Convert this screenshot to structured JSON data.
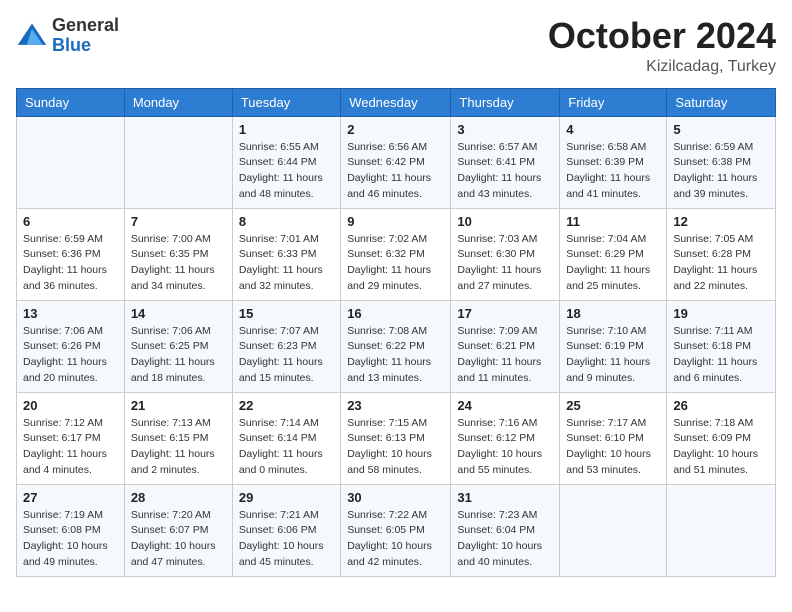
{
  "logo": {
    "general": "General",
    "blue": "Blue"
  },
  "header": {
    "month": "October 2024",
    "location": "Kizilcadag, Turkey"
  },
  "weekdays": [
    "Sunday",
    "Monday",
    "Tuesday",
    "Wednesday",
    "Thursday",
    "Friday",
    "Saturday"
  ],
  "weeks": [
    [
      {
        "day": "",
        "sunrise": "",
        "sunset": "",
        "daylight": ""
      },
      {
        "day": "",
        "sunrise": "",
        "sunset": "",
        "daylight": ""
      },
      {
        "day": "1",
        "sunrise": "Sunrise: 6:55 AM",
        "sunset": "Sunset: 6:44 PM",
        "daylight": "Daylight: 11 hours and 48 minutes."
      },
      {
        "day": "2",
        "sunrise": "Sunrise: 6:56 AM",
        "sunset": "Sunset: 6:42 PM",
        "daylight": "Daylight: 11 hours and 46 minutes."
      },
      {
        "day": "3",
        "sunrise": "Sunrise: 6:57 AM",
        "sunset": "Sunset: 6:41 PM",
        "daylight": "Daylight: 11 hours and 43 minutes."
      },
      {
        "day": "4",
        "sunrise": "Sunrise: 6:58 AM",
        "sunset": "Sunset: 6:39 PM",
        "daylight": "Daylight: 11 hours and 41 minutes."
      },
      {
        "day": "5",
        "sunrise": "Sunrise: 6:59 AM",
        "sunset": "Sunset: 6:38 PM",
        "daylight": "Daylight: 11 hours and 39 minutes."
      }
    ],
    [
      {
        "day": "6",
        "sunrise": "Sunrise: 6:59 AM",
        "sunset": "Sunset: 6:36 PM",
        "daylight": "Daylight: 11 hours and 36 minutes."
      },
      {
        "day": "7",
        "sunrise": "Sunrise: 7:00 AM",
        "sunset": "Sunset: 6:35 PM",
        "daylight": "Daylight: 11 hours and 34 minutes."
      },
      {
        "day": "8",
        "sunrise": "Sunrise: 7:01 AM",
        "sunset": "Sunset: 6:33 PM",
        "daylight": "Daylight: 11 hours and 32 minutes."
      },
      {
        "day": "9",
        "sunrise": "Sunrise: 7:02 AM",
        "sunset": "Sunset: 6:32 PM",
        "daylight": "Daylight: 11 hours and 29 minutes."
      },
      {
        "day": "10",
        "sunrise": "Sunrise: 7:03 AM",
        "sunset": "Sunset: 6:30 PM",
        "daylight": "Daylight: 11 hours and 27 minutes."
      },
      {
        "day": "11",
        "sunrise": "Sunrise: 7:04 AM",
        "sunset": "Sunset: 6:29 PM",
        "daylight": "Daylight: 11 hours and 25 minutes."
      },
      {
        "day": "12",
        "sunrise": "Sunrise: 7:05 AM",
        "sunset": "Sunset: 6:28 PM",
        "daylight": "Daylight: 11 hours and 22 minutes."
      }
    ],
    [
      {
        "day": "13",
        "sunrise": "Sunrise: 7:06 AM",
        "sunset": "Sunset: 6:26 PM",
        "daylight": "Daylight: 11 hours and 20 minutes."
      },
      {
        "day": "14",
        "sunrise": "Sunrise: 7:06 AM",
        "sunset": "Sunset: 6:25 PM",
        "daylight": "Daylight: 11 hours and 18 minutes."
      },
      {
        "day": "15",
        "sunrise": "Sunrise: 7:07 AM",
        "sunset": "Sunset: 6:23 PM",
        "daylight": "Daylight: 11 hours and 15 minutes."
      },
      {
        "day": "16",
        "sunrise": "Sunrise: 7:08 AM",
        "sunset": "Sunset: 6:22 PM",
        "daylight": "Daylight: 11 hours and 13 minutes."
      },
      {
        "day": "17",
        "sunrise": "Sunrise: 7:09 AM",
        "sunset": "Sunset: 6:21 PM",
        "daylight": "Daylight: 11 hours and 11 minutes."
      },
      {
        "day": "18",
        "sunrise": "Sunrise: 7:10 AM",
        "sunset": "Sunset: 6:19 PM",
        "daylight": "Daylight: 11 hours and 9 minutes."
      },
      {
        "day": "19",
        "sunrise": "Sunrise: 7:11 AM",
        "sunset": "Sunset: 6:18 PM",
        "daylight": "Daylight: 11 hours and 6 minutes."
      }
    ],
    [
      {
        "day": "20",
        "sunrise": "Sunrise: 7:12 AM",
        "sunset": "Sunset: 6:17 PM",
        "daylight": "Daylight: 11 hours and 4 minutes."
      },
      {
        "day": "21",
        "sunrise": "Sunrise: 7:13 AM",
        "sunset": "Sunset: 6:15 PM",
        "daylight": "Daylight: 11 hours and 2 minutes."
      },
      {
        "day": "22",
        "sunrise": "Sunrise: 7:14 AM",
        "sunset": "Sunset: 6:14 PM",
        "daylight": "Daylight: 11 hours and 0 minutes."
      },
      {
        "day": "23",
        "sunrise": "Sunrise: 7:15 AM",
        "sunset": "Sunset: 6:13 PM",
        "daylight": "Daylight: 10 hours and 58 minutes."
      },
      {
        "day": "24",
        "sunrise": "Sunrise: 7:16 AM",
        "sunset": "Sunset: 6:12 PM",
        "daylight": "Daylight: 10 hours and 55 minutes."
      },
      {
        "day": "25",
        "sunrise": "Sunrise: 7:17 AM",
        "sunset": "Sunset: 6:10 PM",
        "daylight": "Daylight: 10 hours and 53 minutes."
      },
      {
        "day": "26",
        "sunrise": "Sunrise: 7:18 AM",
        "sunset": "Sunset: 6:09 PM",
        "daylight": "Daylight: 10 hours and 51 minutes."
      }
    ],
    [
      {
        "day": "27",
        "sunrise": "Sunrise: 7:19 AM",
        "sunset": "Sunset: 6:08 PM",
        "daylight": "Daylight: 10 hours and 49 minutes."
      },
      {
        "day": "28",
        "sunrise": "Sunrise: 7:20 AM",
        "sunset": "Sunset: 6:07 PM",
        "daylight": "Daylight: 10 hours and 47 minutes."
      },
      {
        "day": "29",
        "sunrise": "Sunrise: 7:21 AM",
        "sunset": "Sunset: 6:06 PM",
        "daylight": "Daylight: 10 hours and 45 minutes."
      },
      {
        "day": "30",
        "sunrise": "Sunrise: 7:22 AM",
        "sunset": "Sunset: 6:05 PM",
        "daylight": "Daylight: 10 hours and 42 minutes."
      },
      {
        "day": "31",
        "sunrise": "Sunrise: 7:23 AM",
        "sunset": "Sunset: 6:04 PM",
        "daylight": "Daylight: 10 hours and 40 minutes."
      },
      {
        "day": "",
        "sunrise": "",
        "sunset": "",
        "daylight": ""
      },
      {
        "day": "",
        "sunrise": "",
        "sunset": "",
        "daylight": ""
      }
    ]
  ]
}
